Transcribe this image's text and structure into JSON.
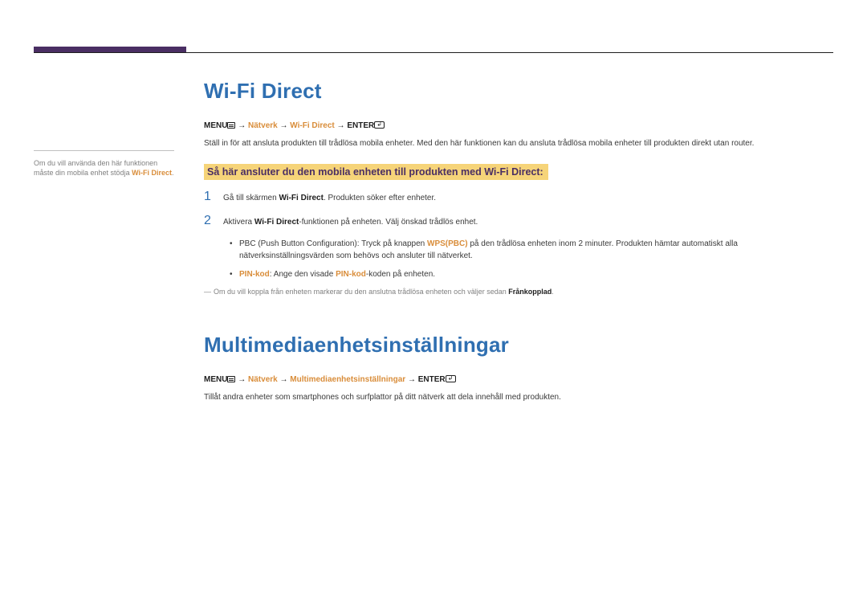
{
  "sidebar": {
    "note_pre": "Om du vill använda den här funktionen måste din mobila enhet stödja ",
    "note_key": "Wi-Fi Direct",
    "note_post": "."
  },
  "section1": {
    "title": "Wi-Fi Direct",
    "crumb": {
      "menu": "MENU",
      "arrow1": " → ",
      "p1": "Nätverk",
      "arrow2": " → ",
      "p2": "Wi-Fi Direct",
      "arrow3": " → ",
      "enter": "ENTER"
    },
    "intro": "Ställ in för att ansluta produkten till trådlösa mobila enheter. Med den här funktionen kan du ansluta trådlösa mobila enheter till produkten direkt utan router.",
    "subheading": "Så här ansluter du den mobila enheten till produkten med Wi-Fi Direct:",
    "steps": [
      {
        "num": "1",
        "pre": "Gå till skärmen ",
        "bold": "Wi-Fi Direct",
        "post": ". Produkten söker efter enheter."
      },
      {
        "num": "2",
        "pre": "Aktivera ",
        "bold": "Wi-Fi Direct",
        "post": "-funktionen på enheten. Välj önskad trådlös enhet."
      }
    ],
    "bullets": [
      {
        "pre": "PBC (Push Button Configuration): Tryck på knappen ",
        "orange": "WPS(PBC)",
        "post": " på den trådlösa enheten inom 2 minuter. Produkten hämtar automatiskt alla nätverksinställningsvärden som behövs och ansluter till nätverket."
      },
      {
        "k1": "PIN-kod",
        "mid": ": Ange den visade ",
        "k2": "PIN-kod",
        "post": "-koden på enheten."
      }
    ],
    "note": {
      "text_pre": "Om du vill koppla från enheten markerar du den anslutna trådlösa enheten och väljer sedan ",
      "bold": "Frånkopplad",
      "text_post": "."
    }
  },
  "section2": {
    "title": "Multimediaenhetsinställningar",
    "crumb": {
      "menu": "MENU",
      "arrow1": " → ",
      "p1": "Nätverk",
      "arrow2": " → ",
      "p2": "Multimediaenhetsinställningar",
      "arrow3": " → ",
      "enter": "ENTER"
    },
    "intro": "Tillåt andra enheter som smartphones och surfplattor på ditt nätverk att dela innehåll med produkten."
  }
}
